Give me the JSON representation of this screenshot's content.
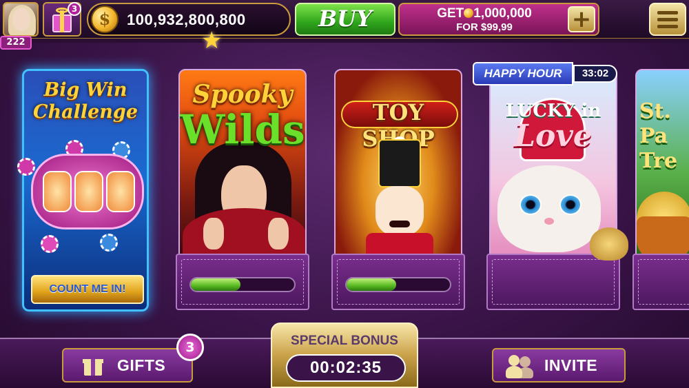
{
  "header": {
    "level": "222",
    "gift_count": "3",
    "coin_balance": "100,932,800,800",
    "coin_symbol": "$",
    "buy_label": "BUY",
    "offer": {
      "line1_prefix": "GET",
      "line1_amount": "1,000,000",
      "line2": "FOR $99,99",
      "plus_label": "+"
    },
    "xp_progress": 0.03
  },
  "games": [
    {
      "id": "big-win-challenge",
      "title_line1": "Big Win",
      "title_line2": "Challenge",
      "action_label": "COUNT ME IN!"
    },
    {
      "id": "spooky-wilds",
      "title_line1": "Spooky",
      "title_line2": "Wilds",
      "progress": 0.48
    },
    {
      "id": "toy-shop",
      "title_line1": "TOY SHOP",
      "progress": 0.48
    },
    {
      "id": "lucky-in-love",
      "badge": "HAPPY HOUR",
      "timer": "33:02",
      "title_line1": "LUCKY in",
      "title_line2": "Love"
    },
    {
      "id": "st-patricks-treasure",
      "title_line1": "St. Pa",
      "title_line2": "Tre"
    }
  ],
  "footer": {
    "gifts_label": "GIFTS",
    "gifts_count": "3",
    "special_bonus_label": "SPECIAL BONUS",
    "special_bonus_timer": "00:02:35",
    "invite_label": "INVITE"
  },
  "colors": {
    "accent_gold": "#c89b3c",
    "buy_green": "#2fa51c",
    "offer_magenta": "#7a1458",
    "bg_purple": "#3a1448"
  }
}
